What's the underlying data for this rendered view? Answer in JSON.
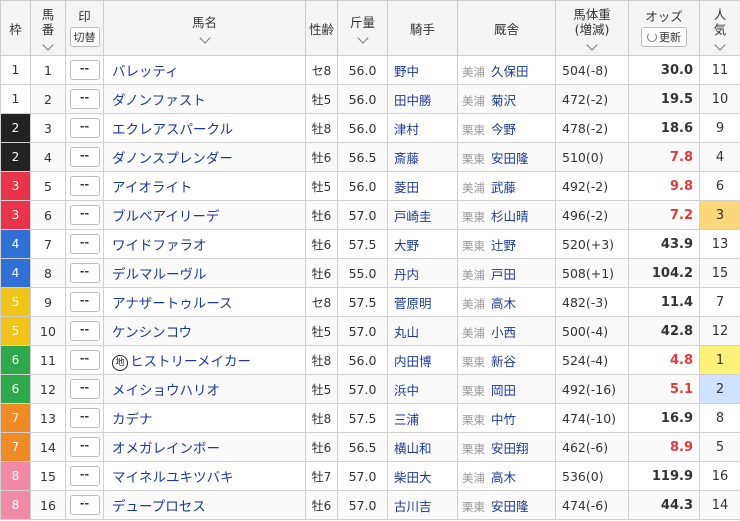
{
  "header": {
    "waku": "枠",
    "umaban_1": "馬",
    "umaban_2": "番",
    "mark": "印",
    "mark_toggle": "切替",
    "name": "馬名",
    "sex_age": "性齢",
    "kinryo": "斤量",
    "jockey": "騎手",
    "stable": "厩舎",
    "bw_1": "馬体重",
    "bw_2": "(増減)",
    "odds": "オッズ",
    "odds_update": "更新",
    "pop_1": "人",
    "pop_2": "気"
  },
  "colors": {
    "waku": [
      "#ffffff",
      "#222222",
      "#e8334a",
      "#2f6fd6",
      "#f0c419",
      "#2da84a",
      "#f08a24",
      "#f08aa6"
    ],
    "waku_text": [
      "#333333",
      "#ffffff",
      "#ffffff",
      "#ffffff",
      "#ffffff",
      "#ffffff",
      "#ffffff",
      "#ffffff"
    ],
    "odds_fav": "#e23b3b",
    "pop1_bg": "#fff27a",
    "pop2_bg": "#cfe3ff",
    "pop3_bg": "#f9d77a"
  },
  "rows": [
    {
      "waku": "1",
      "umaban": "1",
      "mark": "--",
      "name": "バレッティ",
      "sex": "セ8",
      "kinryo": "56.0",
      "jockey": "野中",
      "region": "美浦",
      "trainer": "久保田",
      "bw": "504(-8)",
      "odds": "30.0",
      "pop": "11"
    },
    {
      "waku": "1",
      "umaban": "2",
      "mark": "--",
      "name": "ダノンファスト",
      "sex": "牡5",
      "kinryo": "56.0",
      "jockey": "田中勝",
      "region": "美浦",
      "trainer": "菊沢",
      "bw": "472(-2)",
      "odds": "19.5",
      "pop": "10"
    },
    {
      "waku": "2",
      "umaban": "3",
      "mark": "--",
      "name": "エクレアスパークル",
      "sex": "牡8",
      "kinryo": "56.0",
      "jockey": "津村",
      "region": "栗東",
      "trainer": "今野",
      "bw": "478(-2)",
      "odds": "18.6",
      "pop": "9"
    },
    {
      "waku": "2",
      "umaban": "4",
      "mark": "--",
      "name": "ダノンスプレンダー",
      "sex": "牡6",
      "kinryo": "56.5",
      "jockey": "斎藤",
      "region": "栗東",
      "trainer": "安田隆",
      "bw": "510(0)",
      "odds": "7.8",
      "pop": "4"
    },
    {
      "waku": "3",
      "umaban": "5",
      "mark": "--",
      "name": "アイオライト",
      "sex": "牡5",
      "kinryo": "56.0",
      "jockey": "菱田",
      "region": "美浦",
      "trainer": "武藤",
      "bw": "492(-2)",
      "odds": "9.8",
      "pop": "6"
    },
    {
      "waku": "3",
      "umaban": "6",
      "mark": "--",
      "name": "ブルベアイリーデ",
      "sex": "牡6",
      "kinryo": "57.0",
      "jockey": "戸崎圭",
      "region": "栗東",
      "trainer": "杉山晴",
      "bw": "496(-2)",
      "odds": "7.2",
      "pop": "3"
    },
    {
      "waku": "4",
      "umaban": "7",
      "mark": "--",
      "name": "ワイドファラオ",
      "sex": "牡6",
      "kinryo": "57.5",
      "jockey": "大野",
      "region": "栗東",
      "trainer": "辻野",
      "bw": "520(+3)",
      "odds": "43.9",
      "pop": "13"
    },
    {
      "waku": "4",
      "umaban": "8",
      "mark": "--",
      "name": "デルマルーヴル",
      "sex": "牡6",
      "kinryo": "55.0",
      "jockey": "丹内",
      "region": "美浦",
      "trainer": "戸田",
      "bw": "508(+1)",
      "odds": "104.2",
      "pop": "15"
    },
    {
      "waku": "5",
      "umaban": "9",
      "mark": "--",
      "name": "アナザートゥルース",
      "sex": "セ8",
      "kinryo": "57.5",
      "jockey": "菅原明",
      "region": "美浦",
      "trainer": "高木",
      "bw": "482(-3)",
      "odds": "11.4",
      "pop": "7"
    },
    {
      "waku": "5",
      "umaban": "10",
      "mark": "--",
      "name": "ケンシンコウ",
      "sex": "牡5",
      "kinryo": "57.0",
      "jockey": "丸山",
      "region": "美浦",
      "trainer": "小西",
      "bw": "500(-4)",
      "odds": "42.8",
      "pop": "12"
    },
    {
      "waku": "6",
      "umaban": "11",
      "mark": "--",
      "name": "ヒストリーメイカー",
      "prefix": "地",
      "sex": "牡8",
      "kinryo": "56.0",
      "jockey": "内田博",
      "region": "栗東",
      "trainer": "新谷",
      "bw": "524(-4)",
      "odds": "4.8",
      "pop": "1"
    },
    {
      "waku": "6",
      "umaban": "12",
      "mark": "--",
      "name": "メイショウハリオ",
      "sex": "牡5",
      "kinryo": "57.0",
      "jockey": "浜中",
      "region": "栗東",
      "trainer": "岡田",
      "bw": "492(-16)",
      "odds": "5.1",
      "pop": "2"
    },
    {
      "waku": "7",
      "umaban": "13",
      "mark": "--",
      "name": "カデナ",
      "sex": "牡8",
      "kinryo": "57.5",
      "jockey": "三浦",
      "region": "栗東",
      "trainer": "中竹",
      "bw": "474(-10)",
      "odds": "16.9",
      "pop": "8"
    },
    {
      "waku": "7",
      "umaban": "14",
      "mark": "--",
      "name": "オメガレインボー",
      "sex": "牡6",
      "kinryo": "56.5",
      "jockey": "横山和",
      "region": "栗東",
      "trainer": "安田翔",
      "bw": "462(-6)",
      "odds": "8.9",
      "pop": "5"
    },
    {
      "waku": "8",
      "umaban": "15",
      "mark": "--",
      "name": "マイネルユキツバキ",
      "sex": "牡7",
      "kinryo": "57.0",
      "jockey": "柴田大",
      "region": "美浦",
      "trainer": "高木",
      "bw": "536(0)",
      "odds": "119.9",
      "pop": "16"
    },
    {
      "waku": "8",
      "umaban": "16",
      "mark": "--",
      "name": "デュープロセス",
      "sex": "牡6",
      "kinryo": "57.0",
      "jockey": "古川吉",
      "region": "栗東",
      "trainer": "安田隆",
      "bw": "474(-6)",
      "odds": "44.3",
      "pop": "14"
    }
  ]
}
